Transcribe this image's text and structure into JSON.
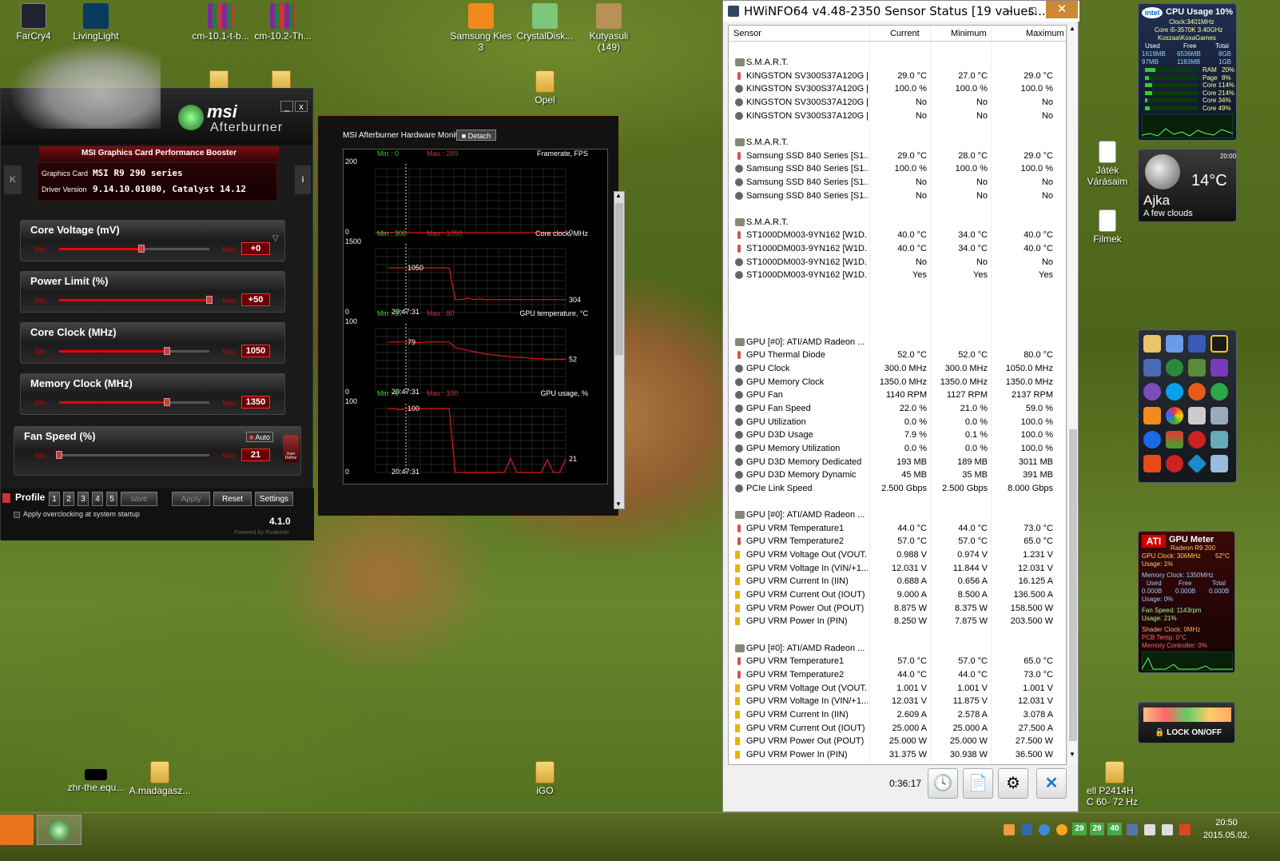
{
  "desktop_icons": [
    {
      "label": "FarCry4",
      "x": "fc4"
    },
    {
      "label": "LivingLight"
    },
    {
      "label": "cm-10.1-t-b..."
    },
    {
      "label": "cm-10.2-Th..."
    },
    {
      "label": "Samsung Kies 3"
    },
    {
      "label": "CrystalDisk..."
    },
    {
      "label": "Kutyasuli (149)"
    },
    {
      "label": "Opel"
    },
    {
      "label": "Játék Várásaim"
    },
    {
      "label": "Filmek"
    },
    {
      "label": "zhr-the.equ..."
    },
    {
      "label": "A.madagasz..."
    },
    {
      "label": "iGO"
    },
    {
      "label": "ell P2414H C 60- 72 Hz"
    }
  ],
  "msi": {
    "brand": "msi",
    "product": "Afterburner",
    "tagline": "MSI Graphics Card Performance Booster",
    "graphics_card_label": "Graphics Card",
    "graphics_card": "MSI R9 290 series",
    "driver_label": "Driver Version",
    "driver": "9.14.10.01080, Catalyst 14.12",
    "min_label": "Min",
    "max_label": "Max",
    "sliders": [
      {
        "label": "Core Voltage (mV)",
        "value": "+0",
        "pos": 0.55
      },
      {
        "label": "Power Limit (%)",
        "value": "+50",
        "pos": 1.0
      },
      {
        "label": "Core Clock (MHz)",
        "value": "1050",
        "pos": 0.72
      },
      {
        "label": "Memory Clock (MHz)",
        "value": "1350",
        "pos": 0.72
      },
      {
        "label": "Fan Speed (%)",
        "value": "21",
        "pos": 0.0,
        "auto": "Auto",
        "user_define": "User Define"
      }
    ],
    "profile_label": "Profile",
    "profile_slots": [
      "1",
      "2",
      "3",
      "4",
      "5"
    ],
    "save_label": "save",
    "apply_label": "Apply",
    "reset_label": "Reset",
    "settings_label": "Settings",
    "startup_label": "Apply overclocking at system startup",
    "version": "4.1.0",
    "powered_by": "Powered by Rivatuner"
  },
  "hwmon": {
    "title": "MSI Afterburner Hardware Monitor",
    "detach": "Detach",
    "time_label": "20:47:31",
    "graphs": [
      {
        "name": "Framerate, FPS",
        "ymin": 0,
        "ymax": 200,
        "min_text": "Min : 0",
        "max_text": "Max : 289",
        "current": "0",
        "peak": ""
      },
      {
        "name": "Core clock, MHz",
        "ymin": 0,
        "ymax": 1500,
        "min_text": "Min : 300",
        "max_text": "Max : 1050",
        "current": "304",
        "peak": "1050"
      },
      {
        "name": "GPU temperature, °C",
        "ymin": 0,
        "ymax": 100,
        "min_text": "Min : 37",
        "max_text": "Max : 80",
        "current": "52",
        "peak": "79"
      },
      {
        "name": "GPU usage, %",
        "ymin": 0,
        "ymax": 100,
        "min_text": "Min : 0",
        "max_text": "Max : 100",
        "current": "21",
        "peak": "100"
      }
    ]
  },
  "hwinfo": {
    "title": "HWiNFO64 v4.48-2350 Sensor Status [19 values...",
    "columns": [
      "Sensor",
      "Current",
      "Minimum",
      "Maximum"
    ],
    "rows": [
      {
        "type": "head",
        "name": "S.M.A.R.T."
      },
      {
        "type": "thermo",
        "name": "KINGSTON SV300S37A120G [...",
        "cur": "29.0 °C",
        "min": "27.0 °C",
        "max": "29.0 °C"
      },
      {
        "type": "dot",
        "name": "KINGSTON SV300S37A120G [...",
        "cur": "100.0 %",
        "min": "100.0 %",
        "max": "100.0 %"
      },
      {
        "type": "dot",
        "name": "KINGSTON SV300S37A120G [...",
        "cur": "No",
        "min": "No",
        "max": "No"
      },
      {
        "type": "dot",
        "name": "KINGSTON SV300S37A120G [...",
        "cur": "No",
        "min": "No",
        "max": "No"
      },
      {
        "type": "blank"
      },
      {
        "type": "head",
        "name": "S.M.A.R.T."
      },
      {
        "type": "thermo",
        "name": "Samsung SSD 840 Series [S1...",
        "cur": "29.0 °C",
        "min": "28.0 °C",
        "max": "29.0 °C"
      },
      {
        "type": "dot",
        "name": "Samsung SSD 840 Series [S1...",
        "cur": "100.0 %",
        "min": "100.0 %",
        "max": "100.0 %"
      },
      {
        "type": "dot",
        "name": "Samsung SSD 840 Series [S1...",
        "cur": "No",
        "min": "No",
        "max": "No"
      },
      {
        "type": "dot",
        "name": "Samsung SSD 840 Series [S1...",
        "cur": "No",
        "min": "No",
        "max": "No"
      },
      {
        "type": "blank"
      },
      {
        "type": "head",
        "name": "S.M.A.R.T."
      },
      {
        "type": "thermo",
        "name": "ST1000DM003-9YN162 [W1D...",
        "cur": "40.0 °C",
        "min": "34.0 °C",
        "max": "40.0 °C"
      },
      {
        "type": "thermo",
        "name": "ST1000DM003-9YN162 [W1D...",
        "cur": "40.0 °C",
        "min": "34.0 °C",
        "max": "40.0 °C"
      },
      {
        "type": "dot",
        "name": "ST1000DM003-9YN162 [W1D...",
        "cur": "No",
        "min": "No",
        "max": "No"
      },
      {
        "type": "dot",
        "name": "ST1000DM003-9YN162 [W1D...",
        "cur": "Yes",
        "min": "Yes",
        "max": "Yes"
      },
      {
        "type": "blank"
      },
      {
        "type": "blank"
      },
      {
        "type": "blank"
      },
      {
        "type": "blank"
      },
      {
        "type": "head",
        "name": "GPU [#0]: ATI/AMD Radeon ..."
      },
      {
        "type": "thermo",
        "name": "GPU Thermal Diode",
        "cur": "52.0 °C",
        "min": "52.0 °C",
        "max": "80.0 °C"
      },
      {
        "type": "dot",
        "name": "GPU Clock",
        "cur": "300.0 MHz",
        "min": "300.0 MHz",
        "max": "1050.0 MHz"
      },
      {
        "type": "dot",
        "name": "GPU Memory Clock",
        "cur": "1350.0 MHz",
        "min": "1350.0 MHz",
        "max": "1350.0 MHz"
      },
      {
        "type": "dot",
        "name": "GPU Fan",
        "cur": "1140 RPM",
        "min": "1127 RPM",
        "max": "2137 RPM"
      },
      {
        "type": "dot",
        "name": "GPU Fan Speed",
        "cur": "22.0 %",
        "min": "21.0 %",
        "max": "59.0 %"
      },
      {
        "type": "dot",
        "name": "GPU Utilization",
        "cur": "0.0 %",
        "min": "0.0 %",
        "max": "100.0 %"
      },
      {
        "type": "dot",
        "name": "GPU D3D Usage",
        "cur": "7.9 %",
        "min": "0.1 %",
        "max": "100.0 %"
      },
      {
        "type": "dot",
        "name": "GPU Memory Utilization",
        "cur": "0.0 %",
        "min": "0.0 %",
        "max": "100.0 %"
      },
      {
        "type": "dot",
        "name": "GPU D3D Memory Dedicated",
        "cur": "193 MB",
        "min": "189 MB",
        "max": "3011 MB"
      },
      {
        "type": "dot",
        "name": "GPU D3D Memory Dynamic",
        "cur": "45 MB",
        "min": "35 MB",
        "max": "391 MB"
      },
      {
        "type": "dot",
        "name": "PCIe Link Speed",
        "cur": "2.500 Gbps",
        "min": "2.500 Gbps",
        "max": "8.000 Gbps"
      },
      {
        "type": "blank"
      },
      {
        "type": "head",
        "name": "GPU [#0]: ATI/AMD Radeon ..."
      },
      {
        "type": "thermo",
        "name": "GPU VRM Temperature1",
        "cur": "44.0 °C",
        "min": "44.0 °C",
        "max": "73.0 °C"
      },
      {
        "type": "thermo",
        "name": "GPU VRM Temperature2",
        "cur": "57.0 °C",
        "min": "57.0 °C",
        "max": "65.0 °C"
      },
      {
        "type": "volt",
        "name": "GPU VRM Voltage Out (VOUT...",
        "cur": "0.988 V",
        "min": "0.974 V",
        "max": "1.231 V"
      },
      {
        "type": "volt",
        "name": "GPU VRM Voltage In (VIN/+1...",
        "cur": "12.031 V",
        "min": "11.844 V",
        "max": "12.031 V"
      },
      {
        "type": "volt",
        "name": "GPU VRM Current In (IIN)",
        "cur": "0.688 A",
        "min": "0.656 A",
        "max": "16.125 A"
      },
      {
        "type": "volt",
        "name": "GPU VRM Current Out (IOUT)",
        "cur": "9.000 A",
        "min": "8.500 A",
        "max": "136.500 A"
      },
      {
        "type": "volt",
        "name": "GPU VRM Power Out (POUT)",
        "cur": "8.875 W",
        "min": "8.375 W",
        "max": "158.500 W"
      },
      {
        "type": "volt",
        "name": "GPU VRM Power In (PIN)",
        "cur": "8.250 W",
        "min": "7.875 W",
        "max": "203.500 W"
      },
      {
        "type": "blank"
      },
      {
        "type": "head",
        "name": "GPU [#0]: ATI/AMD Radeon ..."
      },
      {
        "type": "thermo",
        "name": "GPU VRM Temperature1",
        "cur": "57.0 °C",
        "min": "57.0 °C",
        "max": "65.0 °C"
      },
      {
        "type": "thermo",
        "name": "GPU VRM Temperature2",
        "cur": "44.0 °C",
        "min": "44.0 °C",
        "max": "73.0 °C"
      },
      {
        "type": "volt",
        "name": "GPU VRM Voltage Out (VOUT...",
        "cur": "1.001 V",
        "min": "1.001 V",
        "max": "1.001 V"
      },
      {
        "type": "volt",
        "name": "GPU VRM Voltage In (VIN/+1...",
        "cur": "12.031 V",
        "min": "11.875 V",
        "max": "12.031 V"
      },
      {
        "type": "volt",
        "name": "GPU VRM Current In (IIN)",
        "cur": "2.609 A",
        "min": "2.578 A",
        "max": "3.078 A"
      },
      {
        "type": "volt",
        "name": "GPU VRM Current Out (IOUT)",
        "cur": "25.000 A",
        "min": "25.000 A",
        "max": "27.500 A"
      },
      {
        "type": "volt",
        "name": "GPU VRM Power Out (POUT)",
        "cur": "25.000 W",
        "min": "25.000 W",
        "max": "27.500 W"
      },
      {
        "type": "volt",
        "name": "GPU VRM Power In (PIN)",
        "cur": "31.375 W",
        "min": "30.938 W",
        "max": "36.500 W"
      }
    ],
    "elapsed": "0:36:17"
  },
  "cpu_gadget": {
    "title": "CPU Usage",
    "pct": "10%",
    "clock": "Clock:3401MHz",
    "cpu": "Core i5-3570K 3.40GHz",
    "host": "Koszaa\\KoxaGames",
    "mem_headers": [
      "Used",
      "Free",
      "Total"
    ],
    "mem_rows": [
      [
        "1619MB",
        "6536MB",
        "8GB"
      ],
      [
        "97MB",
        "1183MB",
        "1GB"
      ]
    ],
    "bars": [
      {
        "name": "RAM",
        "pct": "20%",
        "v": 0.2
      },
      {
        "name": "Page",
        "pct": "8%",
        "v": 0.08
      },
      {
        "name": "Core 1",
        "pct": "14%",
        "v": 0.14
      },
      {
        "name": "Core 2",
        "pct": "14%",
        "v": 0.14
      },
      {
        "name": "Core 3",
        "pct": "4%",
        "v": 0.04
      },
      {
        "name": "Core 4",
        "pct": "9%",
        "v": 0.09
      }
    ]
  },
  "weather_gadget": {
    "temp": "14°C",
    "city": "Ajka",
    "condition": "A few clouds",
    "time": "20:00"
  },
  "gpu_gadget": {
    "brand": "ATI",
    "title": "GPU Meter",
    "model": "Radeon R9 200",
    "clock": "GPU Clock: 306MHz",
    "temp": "52°C",
    "usage": "Usage: 1%",
    "mem_clock": "Memory Clock: 1350MHz",
    "mem_headers": [
      "Used",
      "Free",
      "Total"
    ],
    "mem_vals": [
      "0.000B",
      "0.000B",
      "0.000B"
    ],
    "mem_usage": "Usage: 0%",
    "fan": "Fan Speed: 1143rpm",
    "fan_usage": "Usage: 21%",
    "shader": "Shader Clock: 0MHz",
    "pcb": "PCB Temp: 0°C",
    "memctl": "Memory Controller: 0%"
  },
  "lock_gadget": {
    "label": "LOCK ON/OFF"
  },
  "taskbar": {
    "time": "20:50",
    "date": "2015.05.02.",
    "tray_numbers": [
      "29",
      "29",
      "40"
    ]
  }
}
